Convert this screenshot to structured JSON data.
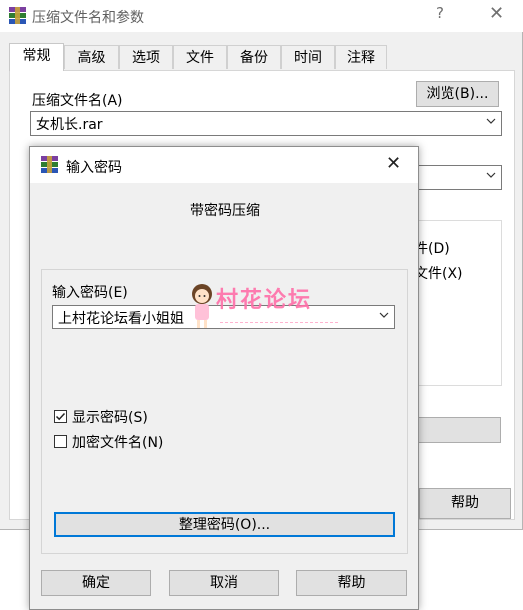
{
  "main_window": {
    "title": "压缩文件名和参数",
    "help_glyph": "?",
    "close_glyph": "✕",
    "tabs": [
      {
        "label": "常规",
        "active": true
      },
      {
        "label": "高级",
        "active": false
      },
      {
        "label": "选项",
        "active": false
      },
      {
        "label": "文件",
        "active": false
      },
      {
        "label": "备份",
        "active": false
      },
      {
        "label": "时间",
        "active": false
      },
      {
        "label": "注释",
        "active": false
      }
    ],
    "archive_name_label": "压缩文件名(A)",
    "browse_button": "浏览(B)...",
    "archive_name_value": "女机长.rar",
    "partial_option_1": "件(D)",
    "partial_option_2": "文件(X)",
    "help_button": "帮助"
  },
  "dialog": {
    "title": "输入密码",
    "close_glyph": "✕",
    "heading": "带密码压缩",
    "password_label": "输入密码(E)",
    "password_value": "上村花论坛看小姐姐",
    "show_password_label": "显示密码(S)",
    "show_password_checked": true,
    "encrypt_filenames_label": "加密文件名(N)",
    "encrypt_filenames_checked": false,
    "organize_button": "整理密码(O)...",
    "ok_button": "确定",
    "cancel_button": "取消",
    "help_button": "帮助"
  },
  "watermark": {
    "text": "村花论坛"
  },
  "icons": {
    "dropdown": "chevron-down-icon",
    "app": "winrar-icon"
  },
  "colors": {
    "focus_border": "#0078d7",
    "watermark": "#ff6fa8"
  }
}
